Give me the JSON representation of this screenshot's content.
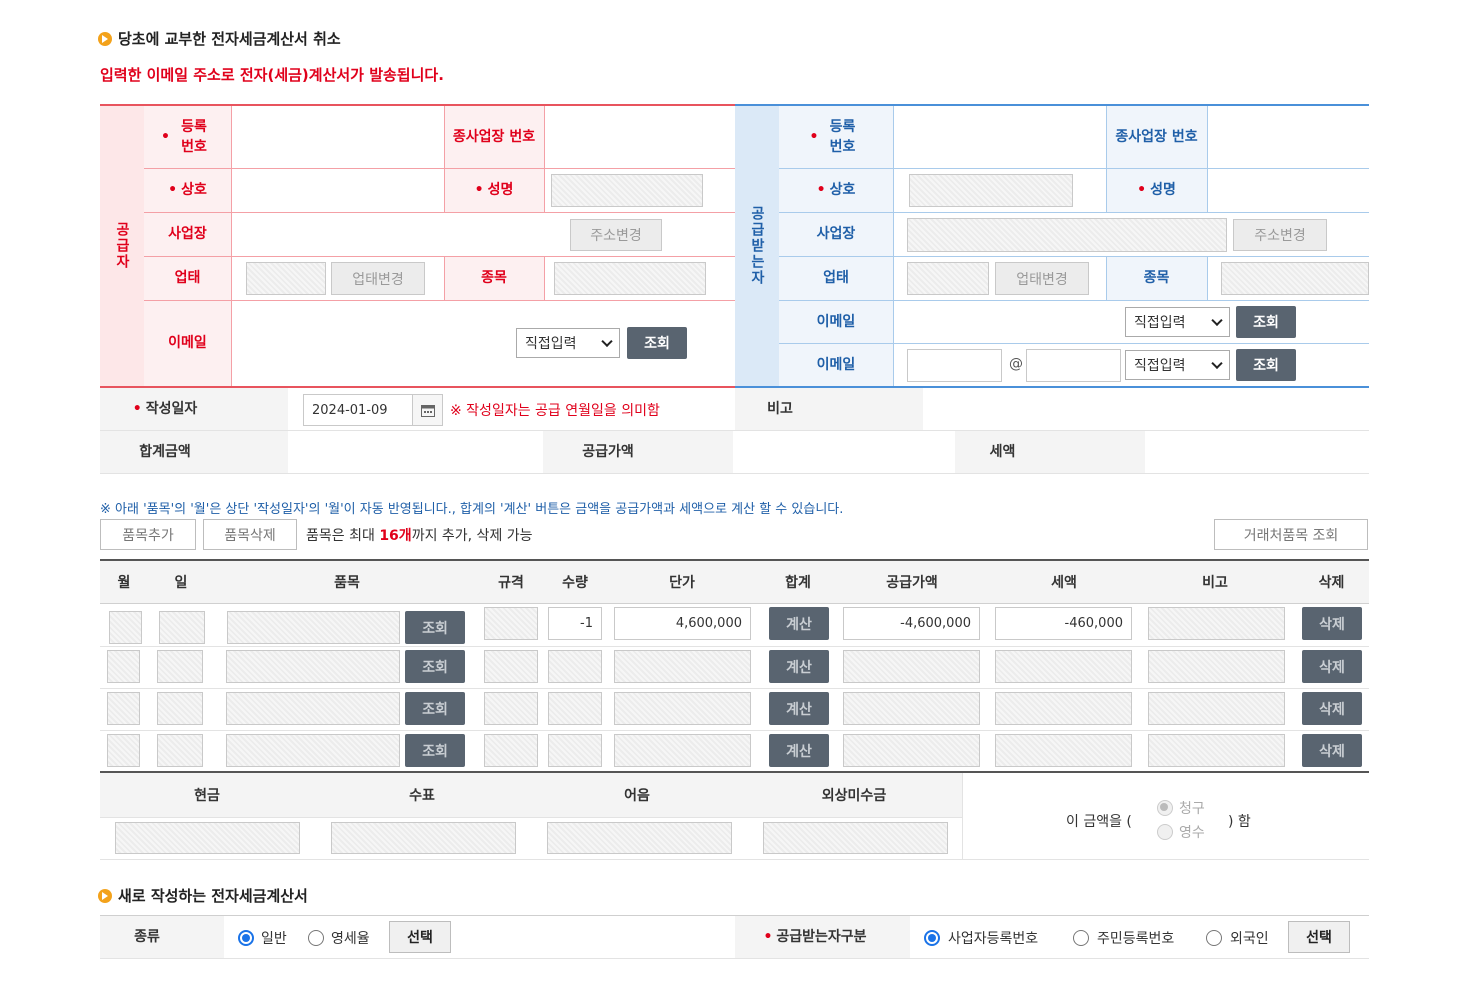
{
  "cancel_section": {
    "title": "당초에 교부한 전자세금계산서 취소",
    "notice": "입력한 이메일 주소로 전자(세금)계산서가 발송됩니다."
  },
  "supplier": {
    "side_label": "공급자",
    "reg_no_label": "등록 번호",
    "sub_biz_label": "종사업장 번호",
    "trade_name_label": "상호",
    "name_label": "성명",
    "address_label": "사업장",
    "address_btn": "주소변경",
    "biz_type_label": "업태",
    "biz_type_btn": "업태변경",
    "item_label": "종목",
    "email_label": "이메일",
    "email_select": "직접입력",
    "lookup_btn": "조회"
  },
  "receiver": {
    "side_label": "공급받는자",
    "reg_no_label": "등록 번호",
    "sub_biz_label": "종사업장 번호",
    "trade_name_label": "상호",
    "name_label": "성명",
    "address_label": "사업장",
    "address_btn": "주소변경",
    "biz_type_label": "업태",
    "biz_type_btn": "업태변경",
    "item_label": "종목",
    "email_label": "이메일",
    "email2_label": "이메일",
    "email_select": "직접입력",
    "email2_select": "직접입력",
    "at_sign": "@",
    "lookup_btn": "조회",
    "lookup2_btn": "조회"
  },
  "summary": {
    "write_date_label": "작성일자",
    "write_date_value": "2024-01-09",
    "write_date_note": "※ 작성일자는 공급 연월일을 의미함",
    "remark_label": "비고",
    "total_label": "합계금액",
    "supply_label": "공급가액",
    "tax_label": "세액"
  },
  "items": {
    "notice": "※ 아래 '품목'의 '월'은 상단 '작성일자'의 '월'이 자동 반영됩니다., 합계의 '계산' 버튼은 금액을 공급가액과 세액으로 계산 할 수 있습니다.",
    "add_btn": "품목추가",
    "del_btn": "품목삭제",
    "limit_prefix": "품목은 최대 ",
    "limit_count": "16개",
    "limit_suffix": "까지 추가, 삭제 가능",
    "partner_btn": "거래처품목 조회",
    "headers": [
      "월",
      "일",
      "품목",
      "규격",
      "수량",
      "단가",
      "합계",
      "공급가액",
      "세액",
      "비고",
      "삭제"
    ],
    "lookup_btn": "조회",
    "calc_btn": "계산",
    "delete_btn": "삭제",
    "rows": [
      {
        "qty": "-1",
        "unit_price": "4,600,000",
        "supply": "-4,600,000",
        "tax": "-460,000"
      },
      {
        "qty": "",
        "unit_price": "",
        "supply": "",
        "tax": ""
      },
      {
        "qty": "",
        "unit_price": "",
        "supply": "",
        "tax": ""
      },
      {
        "qty": "",
        "unit_price": "",
        "supply": "",
        "tax": ""
      }
    ]
  },
  "payment": {
    "cash": "현금",
    "check": "수표",
    "note": "어음",
    "credit": "외상미수금",
    "amount_prefix": "이 금액을 (",
    "amount_suffix": ") 함",
    "opt_claim": "청구",
    "opt_receipt": "영수"
  },
  "new_section": {
    "title": "새로 작성하는 전자세금계산서",
    "type_label": "종류",
    "type_normal": "일반",
    "type_zero": "영세율",
    "select_btn": "선택",
    "receiver_type_label": "공급받는자구분",
    "opt_biz": "사업자등록번호",
    "opt_resident": "주민등록번호",
    "opt_foreigner": "외국인",
    "select_btn2": "선택"
  },
  "colors": {
    "accent_red": "#e0001b",
    "accent_blue": "#1f5fa8",
    "supplier_bg": "#fde7e8",
    "receiver_bg": "#dbe9f7"
  }
}
